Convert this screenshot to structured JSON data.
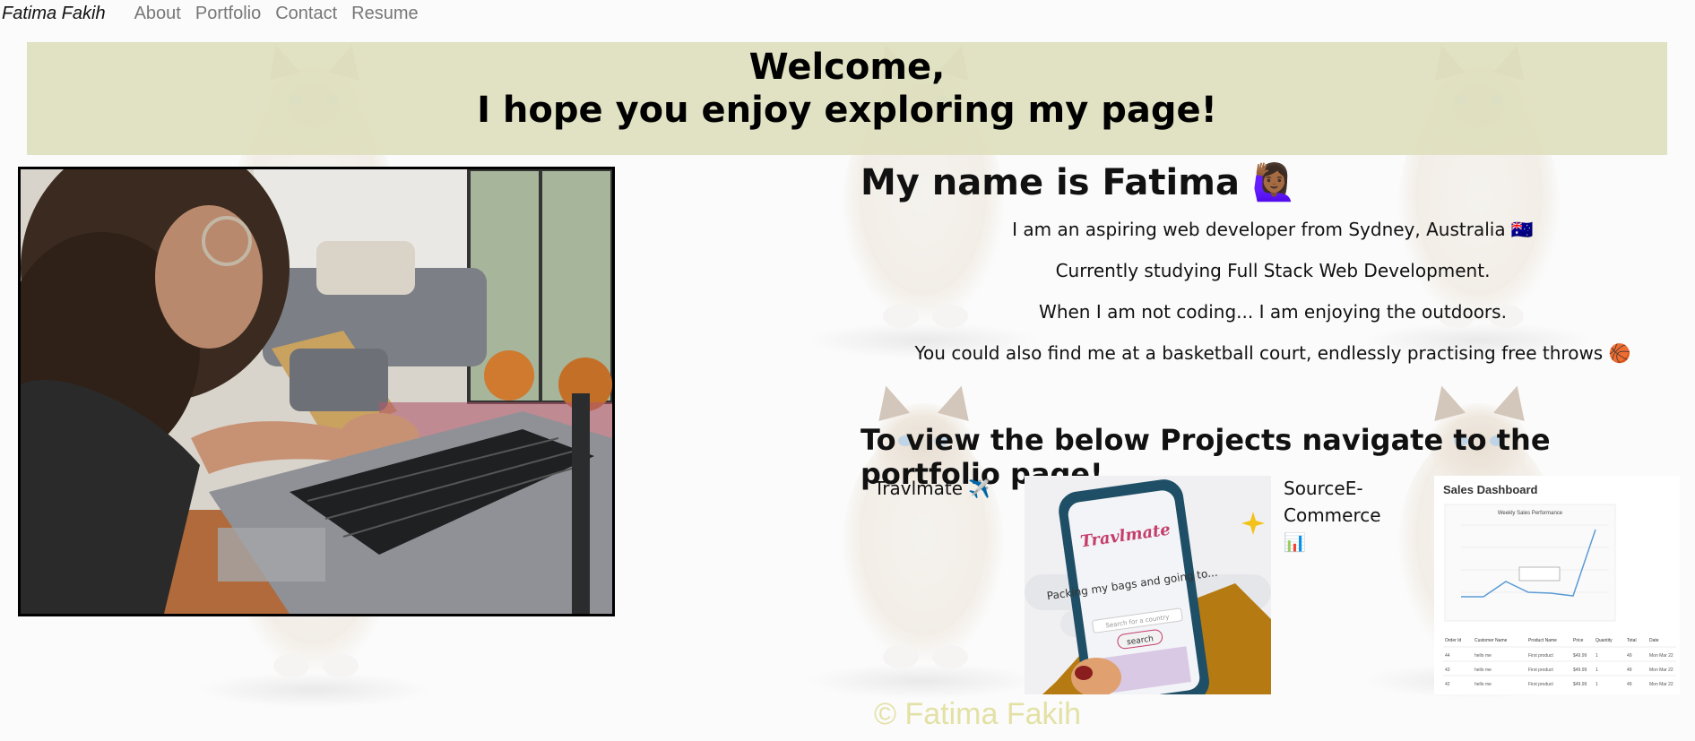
{
  "nav": {
    "brand": "Fatima Fakih",
    "links": [
      "About",
      "Portfolio",
      "Contact",
      "Resume"
    ]
  },
  "banner": {
    "line1": "Welcome,",
    "line2": "I hope you enjoy exploring my page!"
  },
  "intro": {
    "title": "My name is Fatima 🙋🏾‍♀️",
    "lines": [
      "I am an aspiring web developer from Sydney, Australia 🇦🇺",
      "Currently studying Full Stack Web Development.",
      "When I am not coding... I am enjoying the outdoors.",
      "You could also find me at a basketball court, endlessly practising free throws 🏀"
    ]
  },
  "projects": {
    "title": "To view the below Projects navigate to the portfolio page!",
    "items": [
      {
        "label": "Travlmate ✈️",
        "phone_brand": "Travlmate",
        "phone_text": "Packing my bags and going to...",
        "search_placeholder": "Search for a country",
        "search_button": "search"
      },
      {
        "label": "SourceE-Commerce📊",
        "dashboard_title": "Sales Dashboard",
        "chart_title": "Weekly Sales Performance",
        "table_headers": [
          "Order Id",
          "Customer Name",
          "Product Name",
          "Price",
          "Quantity",
          "Total",
          "Date"
        ],
        "table_rows": [
          [
            "44",
            "hello me",
            "First product",
            "$49.99",
            "1",
            "49",
            "Mon Mar 22"
          ],
          [
            "43",
            "hello me",
            "First product",
            "$49.99",
            "1",
            "49",
            "Mon Mar 22"
          ],
          [
            "42",
            "hello me",
            "First product",
            "$49.99",
            "1",
            "49",
            "Mon Mar 22"
          ]
        ]
      }
    ]
  },
  "footer": {
    "text": "© Fatima Fakih"
  },
  "colors": {
    "banner": "#dfe0be",
    "footer_text": "#e3e1a6",
    "nav_link": "#777777"
  }
}
